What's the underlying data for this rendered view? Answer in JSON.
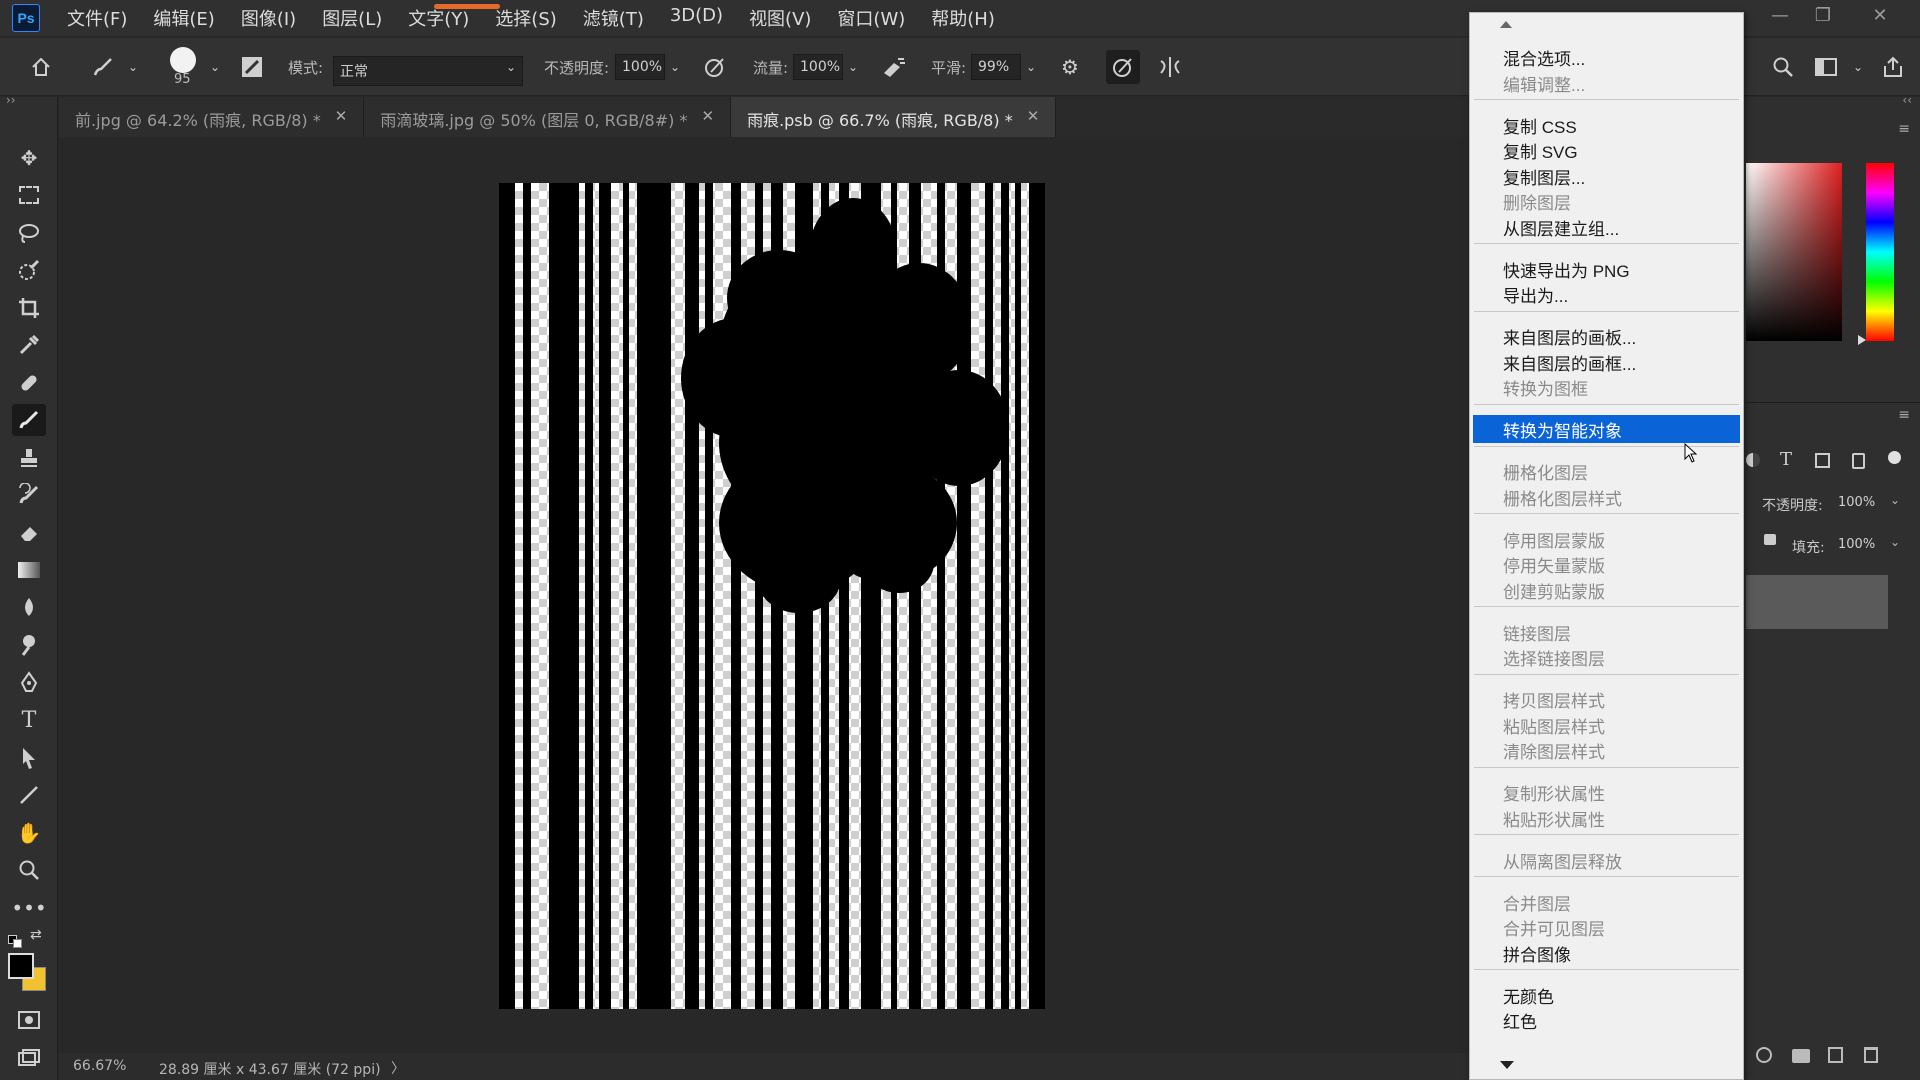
{
  "app": {
    "logo": "Ps"
  },
  "menu": [
    "文件(F)",
    "编辑(E)",
    "图像(I)",
    "图层(L)",
    "文字(Y)",
    "选择(S)",
    "滤镜(T)",
    "3D(D)",
    "视图(V)",
    "窗口(W)",
    "帮助(H)"
  ],
  "options": {
    "brush_size": "95",
    "mode_label": "模式:",
    "mode_value": "正常",
    "opacity_label": "不透明度:",
    "opacity_value": "100%",
    "flow_label": "流量:",
    "flow_value": "100%",
    "smooth_label": "平滑:",
    "smooth_value": "99%"
  },
  "tabs": [
    {
      "label": "前.jpg @ 64.2% (雨痕, RGB/8) *"
    },
    {
      "label": "雨滴玻璃.jpg @ 50% (图层 0, RGB/8#) *"
    },
    {
      "label": "雨痕.psb @ 66.7% (雨痕, RGB/8) *"
    }
  ],
  "status": {
    "zoom": "66.67%",
    "doc_info": "28.89 厘米 x 43.67 厘米 (72 ppi)",
    "arrow": "〉"
  },
  "layers_panel": {
    "opacity_label": "不透明度:",
    "opacity_value": "100%",
    "fill_label": "填充:",
    "fill_value": "100%"
  },
  "context_menu": {
    "groups": [
      [
        {
          "label": "混合选项...",
          "enabled": true
        },
        {
          "label": "编辑调整...",
          "enabled": false
        }
      ],
      [
        {
          "label": "复制 CSS",
          "enabled": true
        },
        {
          "label": "复制 SVG",
          "enabled": true
        },
        {
          "label": "复制图层...",
          "enabled": true
        },
        {
          "label": "删除图层",
          "enabled": false
        },
        {
          "label": "从图层建立组...",
          "enabled": true
        }
      ],
      [
        {
          "label": "快速导出为 PNG",
          "enabled": true
        },
        {
          "label": "导出为...",
          "enabled": true
        }
      ],
      [
        {
          "label": "来自图层的画板...",
          "enabled": true
        },
        {
          "label": "来自图层的画框...",
          "enabled": true
        },
        {
          "label": "转换为图框",
          "enabled": false
        }
      ],
      [
        {
          "label": "转换为智能对象",
          "enabled": true,
          "highlighted": true
        }
      ],
      [
        {
          "label": "栅格化图层",
          "enabled": false
        },
        {
          "label": "栅格化图层样式",
          "enabled": false
        }
      ],
      [
        {
          "label": "停用图层蒙版",
          "enabled": false
        },
        {
          "label": "停用矢量蒙版",
          "enabled": false
        },
        {
          "label": "创建剪贴蒙版",
          "enabled": false
        }
      ],
      [
        {
          "label": "链接图层",
          "enabled": false
        },
        {
          "label": "选择链接图层",
          "enabled": false
        }
      ],
      [
        {
          "label": "拷贝图层样式",
          "enabled": false
        },
        {
          "label": "粘贴图层样式",
          "enabled": false
        },
        {
          "label": "清除图层样式",
          "enabled": false
        }
      ],
      [
        {
          "label": "复制形状属性",
          "enabled": false
        },
        {
          "label": "粘贴形状属性",
          "enabled": false
        }
      ],
      [
        {
          "label": "从隔离图层释放",
          "enabled": false
        }
      ],
      [
        {
          "label": "合并图层",
          "enabled": false
        },
        {
          "label": "合并可见图层",
          "enabled": false
        },
        {
          "label": "拼合图像",
          "enabled": true
        }
      ],
      [
        {
          "label": "无颜色",
          "enabled": true
        },
        {
          "label": "红色",
          "enabled": true
        }
      ]
    ]
  },
  "colors": {
    "highlight": "#0a64d8",
    "accent_bar": "#e8692c",
    "fg_swatch": "#000000",
    "bg_swatch": "#f2c12e"
  }
}
